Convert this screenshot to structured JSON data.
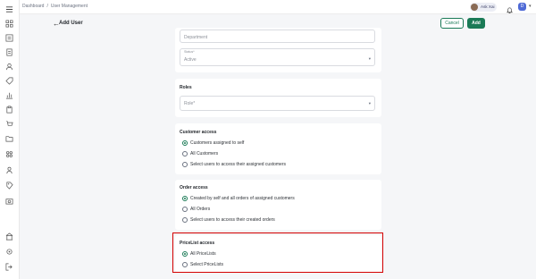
{
  "breadcrumb": [
    "Dashboard",
    "/",
    "User Management"
  ],
  "topbar": {
    "ask_label": "Ask Xai",
    "avatar_letter": "D"
  },
  "page": {
    "title": "Add User",
    "cancel_label": "Cancel",
    "add_label": "Add"
  },
  "fields": {
    "department_placeholder": "Department",
    "status_label": "Status*",
    "status_value": "Active"
  },
  "roles": {
    "title": "Roles",
    "role_placeholder": "Role*"
  },
  "customer_access": {
    "title": "Customer access",
    "options": [
      "Customers assigned to self",
      "All Customers",
      "Select users to access their assigned customers"
    ],
    "selected": 0
  },
  "order_access": {
    "title": "Order access",
    "options": [
      "Created by self and all orders of assigned customers",
      "All Orders",
      "Select users to access their created orders"
    ],
    "selected": 0
  },
  "pricelist_access": {
    "title": "PriceList access",
    "options": [
      "All PriceLists",
      "Select PriceLists"
    ],
    "selected": 0
  },
  "colors": {
    "accent": "#1a7a56",
    "highlight": "#d40000"
  }
}
